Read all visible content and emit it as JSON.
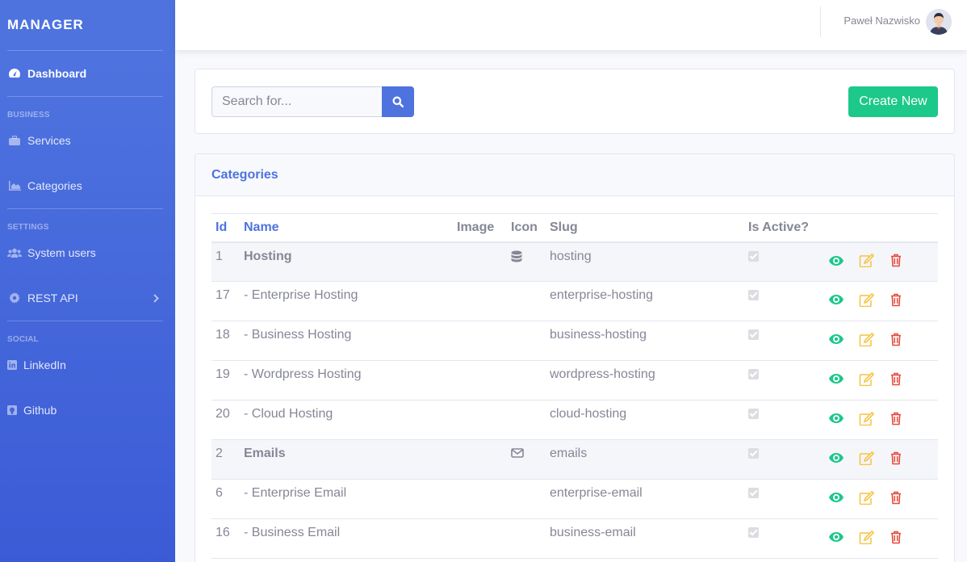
{
  "sidebar": {
    "brand": "MANAGER",
    "dashboard": "Dashboard",
    "heading_business": "BUSINESS",
    "services": "Services",
    "categories": "Categories",
    "heading_settings": "SETTINGS",
    "system_users": "System users",
    "rest_api": "REST API",
    "heading_social": "SOCIAL",
    "linkedin": "LinkedIn",
    "github": "Github"
  },
  "topbar": {
    "user_name": "Paweł Nazwisko"
  },
  "search": {
    "placeholder": "Search for...",
    "value": ""
  },
  "create_label": "Create New",
  "table": {
    "title": "Categories",
    "headers": {
      "id": "Id",
      "name": "Name",
      "image": "Image",
      "icon": "Icon",
      "slug": "Slug",
      "active": "Is Active?"
    },
    "rows": [
      {
        "id": "1",
        "name": "Hosting",
        "slug": "hosting",
        "icon": "database-icon"
      },
      {
        "id": "17",
        "name": "- Enterprise Hosting",
        "slug": "enterprise-hosting"
      },
      {
        "id": "18",
        "name": "- Business Hosting",
        "slug": "business-hosting"
      },
      {
        "id": "19",
        "name": "- Wordpress Hosting",
        "slug": "wordpress-hosting"
      },
      {
        "id": "20",
        "name": "- Cloud Hosting",
        "slug": "cloud-hosting"
      },
      {
        "id": "2",
        "name": "Emails",
        "slug": "emails",
        "icon": "envelope-icon"
      },
      {
        "id": "6",
        "name": "- Enterprise Email",
        "slug": "enterprise-email"
      },
      {
        "id": "16",
        "name": "- Business Email",
        "slug": "business-email"
      }
    ]
  },
  "colors": {
    "primary": "#4e73df",
    "success": "#1cc88a",
    "warning": "#f6c23e",
    "danger": "#e74a3b"
  }
}
